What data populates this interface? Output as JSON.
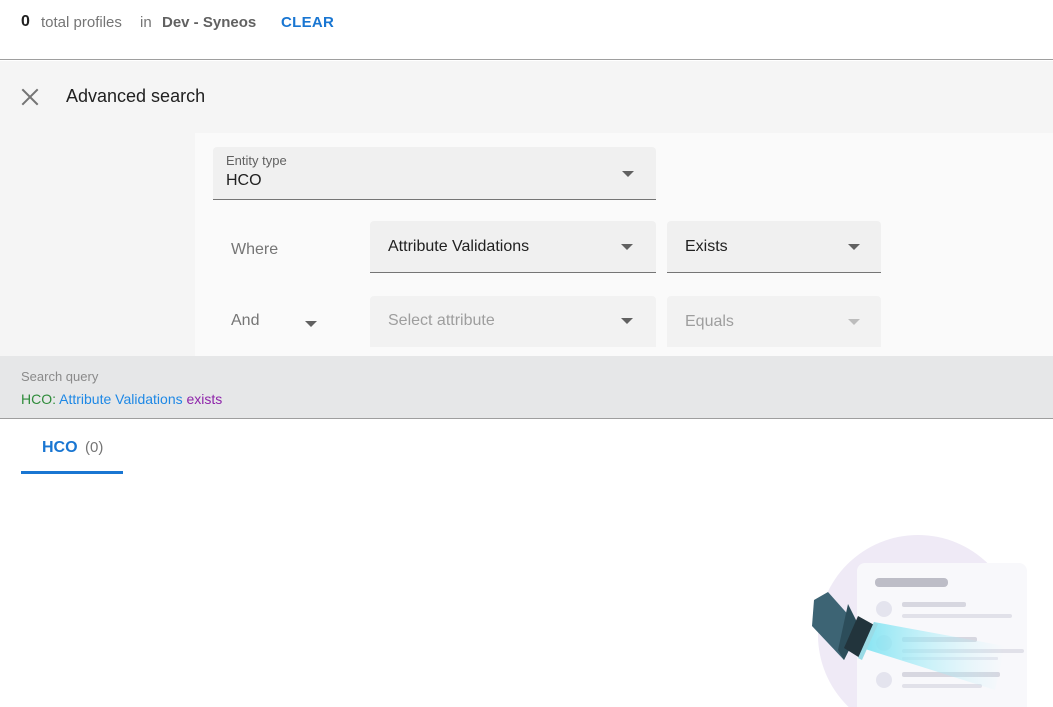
{
  "header": {
    "count": "0",
    "total_label": "total profiles",
    "in_label": "in",
    "tenant": "Dev - Syneos",
    "clear_label": "CLEAR"
  },
  "advanced_search": {
    "title": "Advanced search",
    "entity_type": {
      "label": "Entity type",
      "value": "HCO"
    },
    "rows": [
      {
        "connector": "Where",
        "attribute": "Attribute Validations",
        "operator": "Exists"
      },
      {
        "connector": "And",
        "attribute_placeholder": "Select attribute",
        "operator": "Equals"
      }
    ]
  },
  "search_query": {
    "title": "Search query",
    "entity": "HCO:",
    "attribute": "Attribute Validations",
    "operator": "exists"
  },
  "tabs": [
    {
      "label": "HCO",
      "count": "(0)"
    }
  ],
  "colors": {
    "accent": "#1976d2",
    "query_entity": "#2e8b3a",
    "query_attribute": "#1e88e5",
    "query_operator": "#8e24aa"
  }
}
